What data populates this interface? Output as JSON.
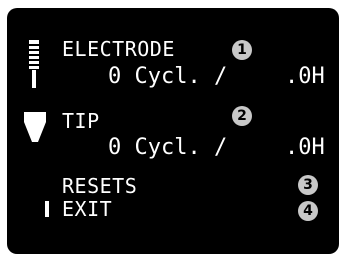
{
  "menu": {
    "electrode": {
      "label": "ELECTRODE",
      "badge": "1",
      "cycles": "0 Cycl. /",
      "hours": ".0H",
      "icon": "electrode-icon"
    },
    "tip": {
      "label": "TIP",
      "badge": "2",
      "cycles": "0 Cycl. /",
      "hours": ".0H",
      "icon": "tip-icon"
    },
    "resets": {
      "label": "RESETS",
      "badge": "3"
    },
    "exit": {
      "label": "EXIT",
      "badge": "4",
      "selected": true
    }
  },
  "colors": {
    "screen": "#000000",
    "text": "#ffffff",
    "badge": "#c8c8c8"
  }
}
